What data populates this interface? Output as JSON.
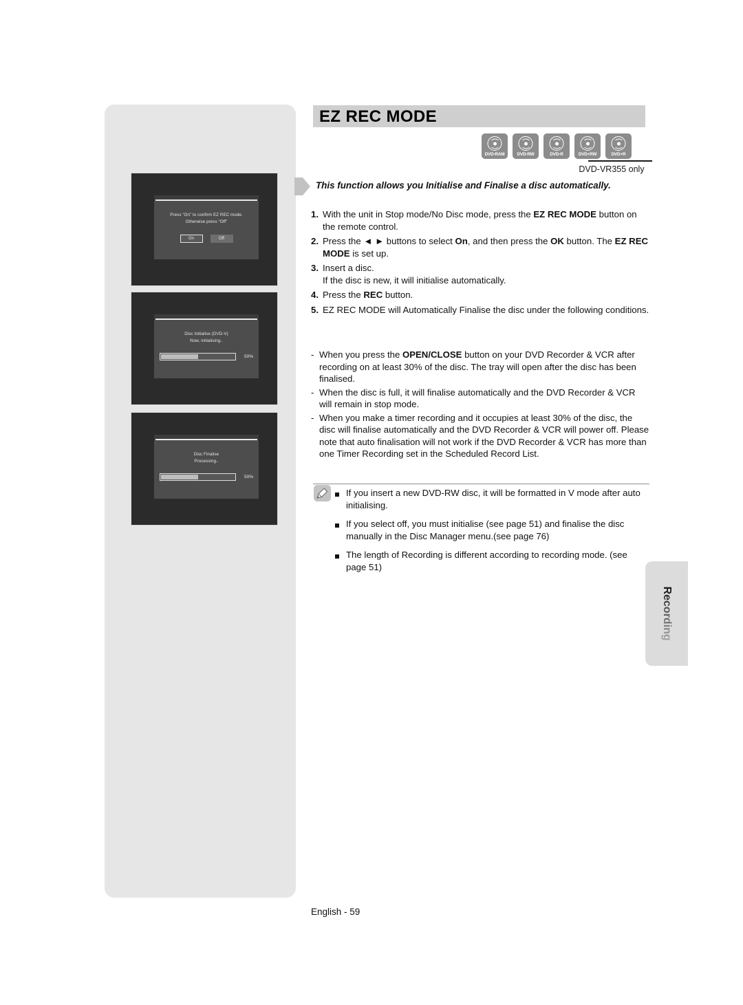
{
  "page": {
    "title": "EZ REC MODE",
    "footer": "English - 59",
    "side_tab": "Recording",
    "model_note": "DVD-VR355 only",
    "intro": "This function allows you Initialise and Finalise a disc automatically."
  },
  "disc_types": [
    {
      "label": "DVD-RAM",
      "icon": "disc-icon"
    },
    {
      "label": "DVD-RW",
      "icon": "disc-icon"
    },
    {
      "label": "DVD-R",
      "icon": "disc-icon"
    },
    {
      "label": "DVD+RW",
      "icon": "disc-icon"
    },
    {
      "label": "DVD+R",
      "icon": "disc-icon"
    }
  ],
  "steps": [
    {
      "num": "1.",
      "parts": [
        {
          "t": "With the unit in Stop mode/No Disc mode, press the ",
          "b": false
        },
        {
          "t": "EZ REC MODE",
          "b": true
        },
        {
          "t": " button on the remote control.",
          "b": false
        }
      ]
    },
    {
      "num": "2.",
      "parts": [
        {
          "t": "Press the ◄ ► buttons to select ",
          "b": false
        },
        {
          "t": "On",
          "b": true
        },
        {
          "t": ", and then press the ",
          "b": false
        },
        {
          "t": "OK",
          "b": true
        },
        {
          "t": " button. The ",
          "b": false
        },
        {
          "t": "EZ REC MODE",
          "b": true
        },
        {
          "t": " is set up.",
          "b": false
        }
      ]
    },
    {
      "num": "3.",
      "parts": [
        {
          "t": "Insert a disc.",
          "b": false
        },
        {
          "t": "\n",
          "b": false
        },
        {
          "t": "If the disc is new, it will initialise automatically.",
          "b": false
        }
      ]
    },
    {
      "num": "4.",
      "parts": [
        {
          "t": "Press the ",
          "b": false
        },
        {
          "t": "REC",
          "b": true
        },
        {
          "t": " button.",
          "b": false
        }
      ]
    },
    {
      "num": "5.",
      "parts": [
        {
          "t": "EZ REC MODE will Automatically Finalise the disc under the following conditions.",
          "b": false
        }
      ]
    }
  ],
  "conditions": [
    {
      "marker": "-",
      "parts": [
        {
          "t": "When you press the ",
          "b": false
        },
        {
          "t": "OPEN/CLOSE",
          "b": true
        },
        {
          "t": " button on your DVD Recorder & VCR after recording on at least 30% of the disc. The tray will open after the disc has been finalised.",
          "b": false
        }
      ]
    },
    {
      "marker": "-",
      "parts": [
        {
          "t": "When the disc is full, it will finalise automatically and the DVD Recorder & VCR will remain in stop mode.",
          "b": false
        }
      ]
    },
    {
      "marker": "-",
      "parts": [
        {
          "t": "When you make a timer recording and it occupies at least 30% of the disc, the disc will finalise automatically and the DVD Recorder & VCR will power off. Please note that auto finalisation will not work if the DVD Recorder & VCR has more than one Timer Recording set in the Scheduled Record List.",
          "b": false
        }
      ]
    }
  ],
  "notes": [
    "If you insert a new DVD-RW disc, it will be formatted in V mode after auto initialising.",
    "If you select off, you must initialise (see page 51) and finalise the disc manually in the Disc Manager menu.(see page 76)",
    "The length of Recording is different according to recording mode. (see page 51)"
  ],
  "screens": [
    {
      "name": "ez-rec-confirm",
      "line1": "Press “On” to confirm EZ REC mode.",
      "line2": "Otherwise press “Off”",
      "buttons": [
        {
          "label": "On",
          "selected": true
        },
        {
          "label": "Off",
          "selected": false
        }
      ]
    },
    {
      "name": "disc-initialise",
      "line1": "Disc Initialise (DVD-V)",
      "line2": "Now, initialising..",
      "progress": "50%"
    },
    {
      "name": "disc-finalise",
      "line1": "Disc Finalise",
      "line2": "Processing..",
      "progress": "50%"
    }
  ],
  "colors": {
    "panel_gray": "#e6e6e6",
    "title_bar": "#cfcfcf",
    "disc_icon": "#8c8c8c",
    "side_tab": "#dcdcdc",
    "osd_bg": "#2b2b2b"
  }
}
